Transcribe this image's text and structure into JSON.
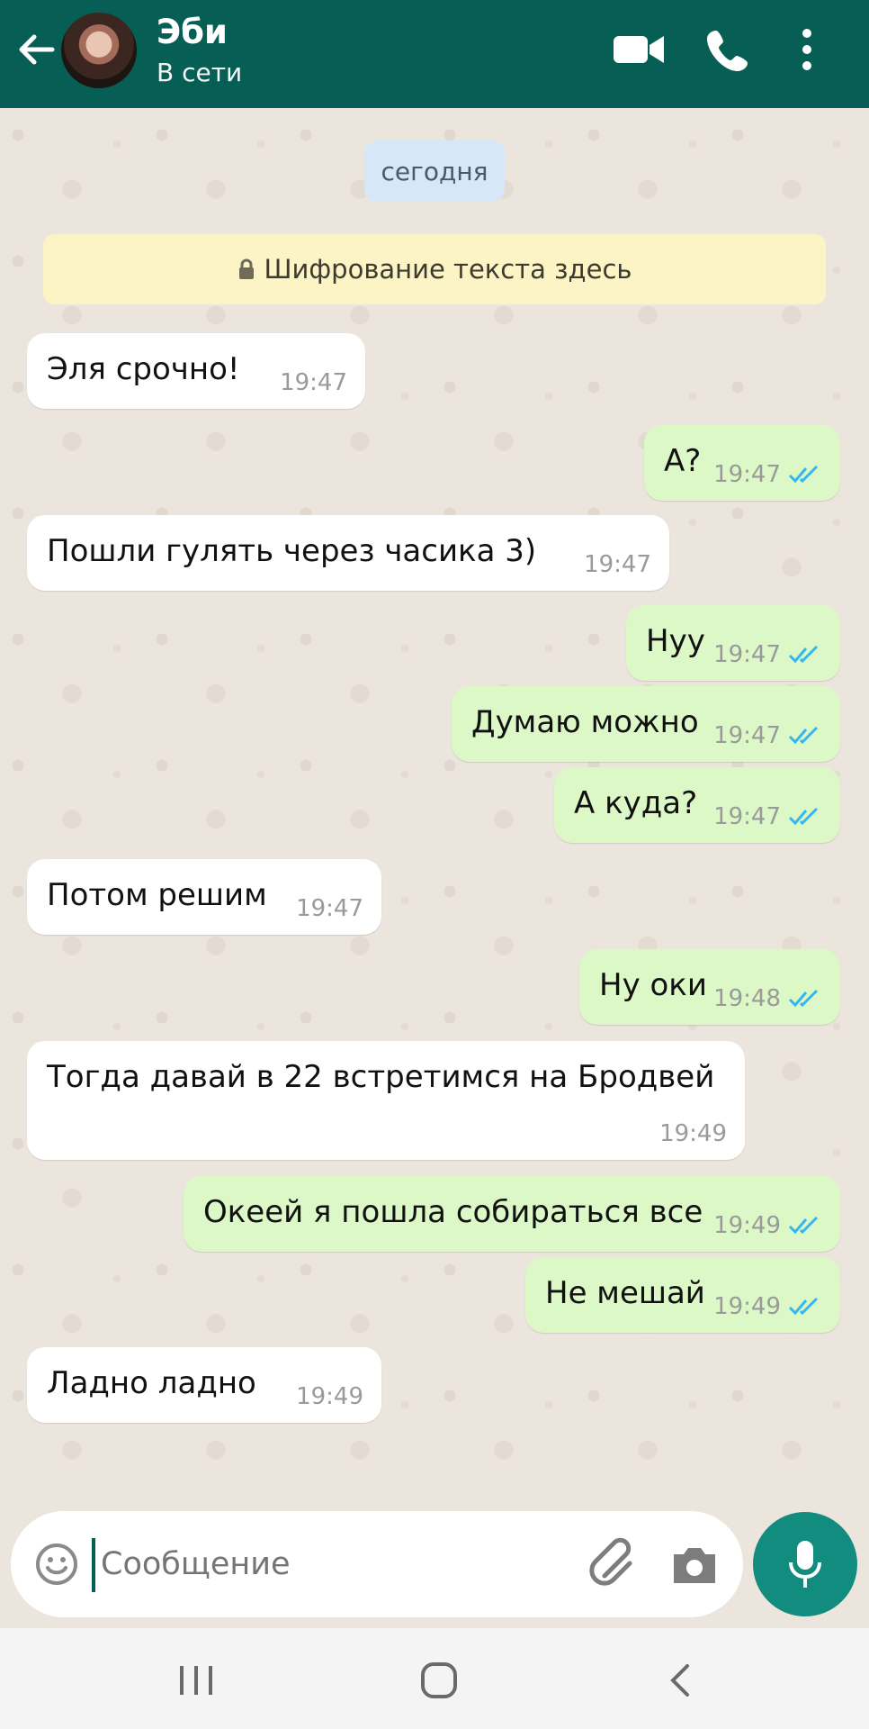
{
  "header": {
    "contact_name": "Эби",
    "status": "В сети"
  },
  "chat": {
    "date_chip": "сегодня",
    "encryption_notice": "Шифрование текста здесь",
    "messages": [
      {
        "direction": "in",
        "text": "Эля срочно!",
        "time": "19:47"
      },
      {
        "direction": "out",
        "text": "А?",
        "time": "19:47",
        "read": true
      },
      {
        "direction": "in",
        "text": "Пошли гулять через часика 3)",
        "time": "19:47"
      },
      {
        "direction": "out",
        "text": "Нуу",
        "time": "19:47",
        "read": true
      },
      {
        "direction": "out",
        "text": "Думаю можно",
        "time": "19:47",
        "read": true
      },
      {
        "direction": "out",
        "text": "А куда?",
        "time": "19:47",
        "read": true
      },
      {
        "direction": "in",
        "text": "Потом решим",
        "time": "19:47"
      },
      {
        "direction": "out",
        "text": "Ну оки",
        "time": "19:48",
        "read": true
      },
      {
        "direction": "in",
        "text": "Тогда давай в 22 встретимся на Бродвей",
        "time": "19:49"
      },
      {
        "direction": "out",
        "text": "Океей я пошла собираться все",
        "time": "19:49",
        "read": true
      },
      {
        "direction": "out",
        "text": "Не мешай",
        "time": "19:49",
        "read": true
      },
      {
        "direction": "in",
        "text": "Ладно ладно",
        "time": "19:49"
      }
    ]
  },
  "composer": {
    "placeholder": "Сообщение"
  },
  "colors": {
    "header": "#075e54",
    "outgoing_bubble": "#dcf8c6",
    "incoming_bubble": "#ffffff",
    "read_ticks": "#34b7f1",
    "mic_button": "#128c7e"
  }
}
